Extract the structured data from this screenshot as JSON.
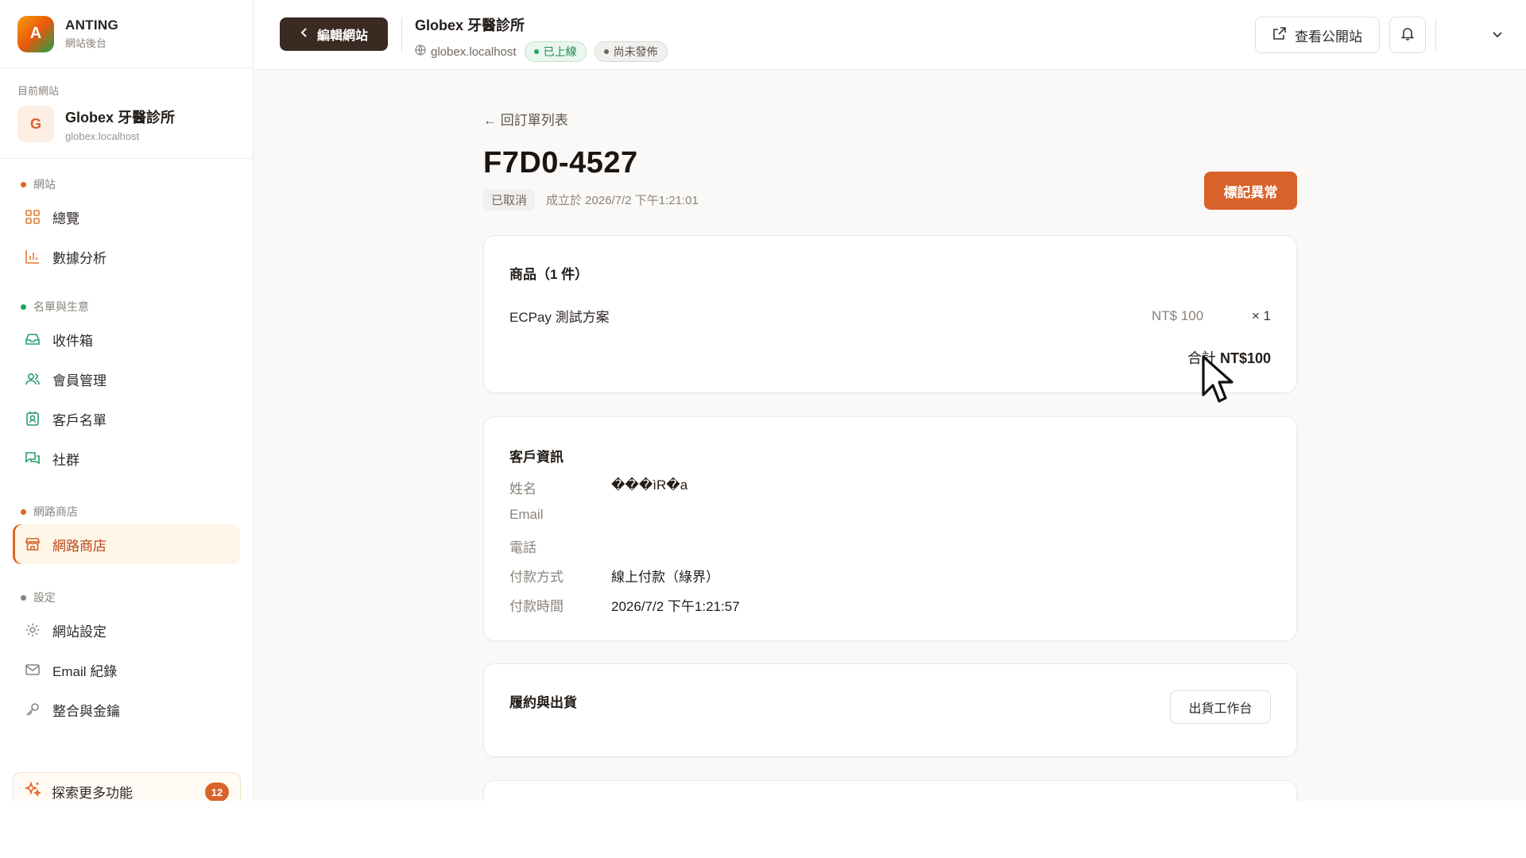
{
  "brand": {
    "logo_letter": "A",
    "name": "ANTING",
    "subtitle": "網站後台"
  },
  "current_site": {
    "caption": "目前網站",
    "avatar_letter": "G",
    "name": "Globex 牙醫診所",
    "domain": "globex.localhost"
  },
  "nav": {
    "groups": [
      {
        "label": "網站",
        "dot_color": "#e0661f",
        "items": [
          {
            "label": "總覽",
            "icon": "grid-icon"
          },
          {
            "label": "數據分析",
            "icon": "bar-chart-icon"
          }
        ]
      },
      {
        "label": "名單與生意",
        "dot_color": "#22a55a",
        "items": [
          {
            "label": "收件箱",
            "icon": "inbox-icon"
          },
          {
            "label": "會員管理",
            "icon": "users-icon"
          },
          {
            "label": "客戶名單",
            "icon": "contact-icon"
          },
          {
            "label": "社群",
            "icon": "chat-icon"
          }
        ]
      },
      {
        "label": "網路商店",
        "dot_color": "#e0661f",
        "items": [
          {
            "label": "網路商店",
            "icon": "store-icon",
            "active": true
          }
        ]
      },
      {
        "label": "設定",
        "dot_color": "#8a837c",
        "items": [
          {
            "label": "網站設定",
            "icon": "gear-icon"
          },
          {
            "label": "Email 紀錄",
            "icon": "mail-icon"
          },
          {
            "label": "整合與金鑰",
            "icon": "key-icon"
          }
        ]
      }
    ],
    "explore": {
      "label": "探索更多功能",
      "count": "12"
    }
  },
  "topbar": {
    "edit_label": "編輯網站",
    "site_name": "Globex 牙醫診所",
    "site_domain": "globex.localhost",
    "status_live": "已上線",
    "status_draft": "尚未發佈",
    "view_public_label": "查看公開站"
  },
  "order": {
    "back_label": "← 回訂單列表",
    "number": "F7D0-4527",
    "status": "已取消",
    "created": "成立於 2026/7/2 下午1:21:01",
    "flag_label": "標記異常"
  },
  "items_card": {
    "title": "商品（1 件）",
    "items": [
      {
        "name": "ECPay 測試方案",
        "price": "NT$ 100",
        "qty": "× 1"
      }
    ],
    "total_label": "合計",
    "total_value": "NT$100"
  },
  "customer_card": {
    "title": "客戶資訊",
    "fields": [
      {
        "label": "姓名",
        "value": "���ìR�a"
      },
      {
        "label": "Email",
        "value": ""
      },
      {
        "label": "電話",
        "value": ""
      },
      {
        "label": "付款方式",
        "value": "線上付款（綠界）"
      },
      {
        "label": "付款時間",
        "value": "2026/7/2 下午1:21:57"
      }
    ]
  },
  "fulfillment_card": {
    "title": "履約與出貨",
    "button_label": "出貨工作台"
  },
  "colors": {
    "accent": "#d9622b",
    "dark_button": "#3a2a22",
    "live_green": "#1f8a4c"
  }
}
